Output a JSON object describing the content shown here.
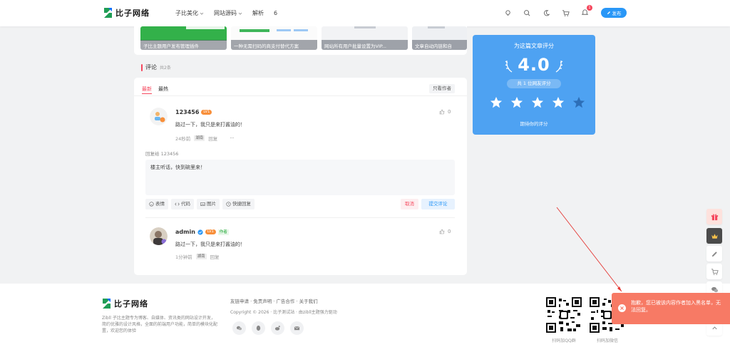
{
  "header": {
    "logo_text": "比子网络",
    "nav": [
      {
        "label": "子比美化",
        "dropdown": true
      },
      {
        "label": "网站源码",
        "dropdown": true
      },
      {
        "label": "解析",
        "dropdown": false
      },
      {
        "label": "6",
        "dropdown": false
      }
    ],
    "notification_count": "1",
    "publish_label": "发布"
  },
  "related_posts": [
    {
      "title": "子比主题用户发布管理插件"
    },
    {
      "title": "一种无需扫码的商支付替代方案"
    },
    {
      "title": "网站所有用户批量设置为VIP..."
    },
    {
      "title": "文章自动内链和自"
    }
  ],
  "rating": {
    "title": "为这篇文章评分",
    "score": "4.0",
    "count_label": "共 1 位网友评分",
    "hint": "期待你的评分",
    "stars_filled": 4,
    "stars_total": 5
  },
  "comments": {
    "title": "评论",
    "count": "共2条",
    "tabs": [
      "最新",
      "最热"
    ],
    "only_author": "只看作者",
    "items": [
      {
        "name": "123456",
        "level": "LV1",
        "is_author": false,
        "text": "路过一下，我只是来打酱油的！",
        "time": "24秒前",
        "location": "湖南",
        "reply": "回复",
        "more": "···",
        "likes": "0"
      },
      {
        "name": "admin",
        "level": "LV1",
        "is_author": true,
        "author_tag": "作者",
        "text": "路过一下，我只是来打酱油的！",
        "time": "1分钟前",
        "location": "湖南",
        "reply": "回复",
        "likes": "0"
      }
    ],
    "reply_to": "回复给 123456",
    "editor_value": "楼主听话，快到碗里来！",
    "tools": [
      "表情",
      "代码",
      "图片",
      "快捷回复"
    ],
    "cancel": "取消",
    "submit": "提交评论"
  },
  "footer": {
    "logo_text": "比子网络",
    "description": "Zibll 子比主题专为博客、自媒体、资讯类的网站设计开发，简约优雅的设计风格，全面的前端用户功能，简单的模块化配置，欢迎您的体验",
    "links": "友链申请 · 免责声明 · 广告合作 · 关于我们",
    "copyright": "Copyright © 2026 · 比子测试站 · 由zibll主题强力驱动",
    "qr_labels": [
      "扫码加QQ群",
      "扫码加微信"
    ]
  },
  "toast": {
    "message": "抱歉，您已被该内容作者加入黑名单，无法回复。"
  },
  "colors": {
    "accent": "#2997f7",
    "rating_bg": "#4ea2f2",
    "danger": "#f5475d",
    "toast_bg": "#f77a65"
  }
}
